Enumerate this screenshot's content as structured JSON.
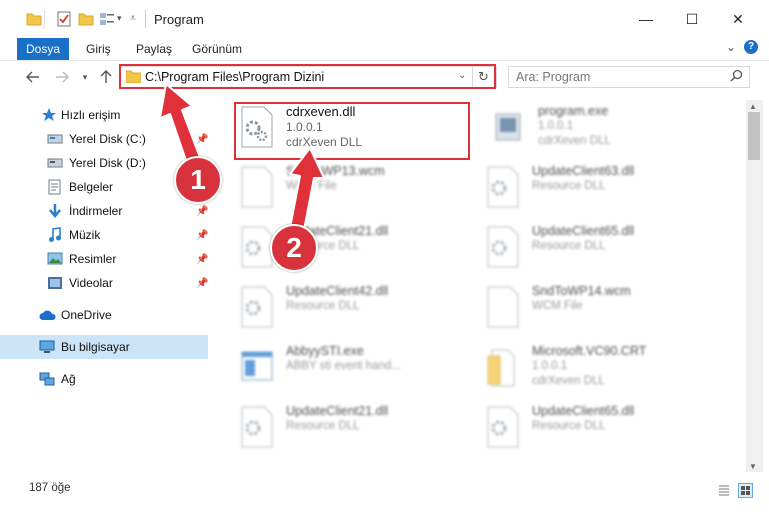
{
  "window": {
    "title": "Program",
    "controls": {
      "minimize": "—",
      "maximize": "☐",
      "close": "✕"
    }
  },
  "ribbon": {
    "tabs": [
      {
        "label": "Dosya",
        "active": true
      },
      {
        "label": "Giriş"
      },
      {
        "label": "Paylaş"
      },
      {
        "label": "Görünüm"
      }
    ],
    "expand_glyph": "⌄",
    "help_glyph": "?"
  },
  "address": {
    "path": "C:\\Program Files\\Program Dizini",
    "search_placeholder": "Ara: Program"
  },
  "sidebar": {
    "items": [
      {
        "label": "Hızlı erişim",
        "icon": "star-icon"
      },
      {
        "label": "Yerel Disk (C:)",
        "icon": "drive-icon",
        "pinned": true
      },
      {
        "label": "Yerel Disk (D:)",
        "icon": "drive-icon",
        "pinned": true
      },
      {
        "label": "Belgeler",
        "icon": "documents-icon",
        "pinned": true
      },
      {
        "label": "İndirmeler",
        "icon": "download-icon",
        "pinned": true
      },
      {
        "label": "Müzik",
        "icon": "music-icon",
        "pinned": true
      },
      {
        "label": "Resimler",
        "icon": "pictures-icon",
        "pinned": true
      },
      {
        "label": "Videolar",
        "icon": "videos-icon",
        "pinned": true
      },
      {
        "label": "OneDrive",
        "icon": "cloud-icon"
      },
      {
        "label": "Bu bilgisayar",
        "icon": "computer-icon",
        "selected": true
      },
      {
        "label": "Ağ",
        "icon": "network-icon"
      }
    ]
  },
  "files": [
    {
      "name": "cdrxeven.dll",
      "line1": "1.0.0.1",
      "line2": "cdrXeven DLL",
      "icon": "dll-file-icon"
    },
    {
      "name": "program.exe",
      "line1": "1.0.0.1",
      "line2": "cdrXeven DLL",
      "icon": "exe-file-icon"
    },
    {
      "name": "SndToWP13.wcm",
      "line1": "WCM File",
      "line2": "",
      "icon": "blank-file-icon"
    },
    {
      "name": "UpdateClient63.dll",
      "line1": "Resource DLL",
      "line2": "",
      "icon": "dll-file-icon"
    },
    {
      "name": "UpdateClient21.dll",
      "line1": "Resource DLL",
      "line2": "",
      "icon": "dll-file-icon"
    },
    {
      "name": "UpdateClient65.dll",
      "line1": "Resource DLL",
      "line2": "",
      "icon": "dll-file-icon"
    },
    {
      "name": "UpdateClient42.dll",
      "line1": "Resource DLL",
      "line2": "",
      "icon": "dll-file-icon"
    },
    {
      "name": "SndToWP14.wcm",
      "line1": "WCM File",
      "line2": "",
      "icon": "blank-file-icon"
    },
    {
      "name": "AbbyySTI.exe",
      "line1": "ABBY sti event hand...",
      "line2": "",
      "icon": "app-window-icon"
    },
    {
      "name": "Microsoft.VC90.CRT",
      "line1": "1.0.0.1",
      "line2": "cdrXeven DLL",
      "icon": "folder-file-icon"
    },
    {
      "name": "UpdateClient21.dll",
      "line1": "Resource DLL",
      "line2": "",
      "icon": "dll-file-icon"
    },
    {
      "name": "UpdateClient65.dll",
      "line1": "Resource DLL",
      "line2": "",
      "icon": "dll-file-icon"
    }
  ],
  "status": {
    "count": "187 öğe"
  },
  "callouts": {
    "one": "1",
    "two": "2"
  },
  "colors": {
    "accent": "#1a6fc9",
    "highlight": "#e0313a",
    "selected": "#cce4f7"
  }
}
